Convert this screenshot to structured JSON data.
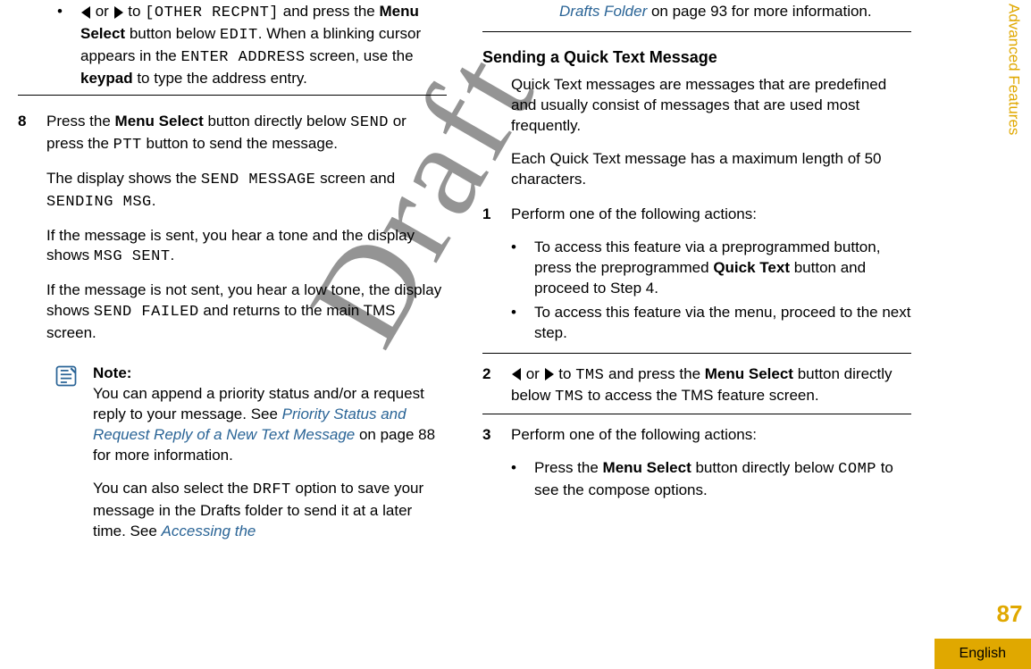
{
  "watermark": "Draft",
  "sidebar": {
    "section": "Advanced Features",
    "page_number": "87",
    "language": "English"
  },
  "left": {
    "cont_bullet": {
      "pre_arrows": "",
      "or": " or ",
      "to": " to ",
      "other_recpnt": "[OTHER RECPNT]",
      "rest1": " and press the ",
      "menu_select": "Menu Select",
      "rest2": " button below ",
      "edit": "EDIT",
      "rest3": ". When a blinking cursor appears in the ",
      "enter_address": "ENTER ADDRESS",
      "rest4": " screen, use the ",
      "keypad": "keypad",
      "rest5": " to type the address entry."
    },
    "step8": {
      "num": "8",
      "p1a": "Press the ",
      "p1b": "Menu Select",
      "p1c": " button directly below ",
      "send": "SEND",
      "p1d": " or press the ",
      "ptt": "PTT",
      "p1e": " button to send the message.",
      "p2a": "The display shows the ",
      "send_message": "SEND MESSAGE",
      "p2b": " screen and ",
      "sending_msg": "SENDING MSG",
      "p2c": ".",
      "p3a": "If the message is sent, you hear a tone and the display shows ",
      "msg_sent": "MSG SENT",
      "p3b": ".",
      "p4a": "If the message is not sent, you hear a low tone, the display shows ",
      "send_failed": "SEND FAILED",
      "p4b": " and returns to the main TMS screen."
    },
    "note": {
      "title": "Note:",
      "p1a": "You can append a priority status and/or a request reply to your message. See ",
      "link1": "Priority Status and Request Reply of a New Text Message",
      "p1b": " on page 88 for more information.",
      "p2a": "You can also select the ",
      "drft": "DRFT",
      "p2b": " option to save your message in the Drafts folder to send it at a later time. See ",
      "link2": "Accessing the"
    }
  },
  "right": {
    "cont_note": {
      "link": "Drafts Folder",
      "rest": " on page 93 for more information."
    },
    "heading": "Sending a Quick Text Message",
    "intro1": "Quick Text messages are messages that are predefined and usually consist of messages that are used most frequently.",
    "intro2": "Each Quick Text message has a maximum length of 50 characters.",
    "step1": {
      "num": "1",
      "text": "Perform one of the following actions:",
      "b1a": "To access this feature via a preprogrammed button, press the preprogrammed ",
      "b1b": "Quick Text",
      "b1c": " button and proceed to Step 4.",
      "b2": "To access this feature via the menu, proceed to the next step."
    },
    "step2": {
      "num": "2",
      "or": " or ",
      "to": " to ",
      "tms": "TMS",
      "rest1": " and press the ",
      "ms": "Menu Select",
      "rest2": " button directly below ",
      "tms2": "TMS",
      "rest3": " to access the TMS feature screen."
    },
    "step3": {
      "num": "3",
      "text": "Perform one of the following actions:",
      "b1a": "Press the ",
      "b1b": "Menu Select",
      "b1c": " button directly below ",
      "comp": "COMP",
      "b1d": " to see the compose options."
    }
  }
}
